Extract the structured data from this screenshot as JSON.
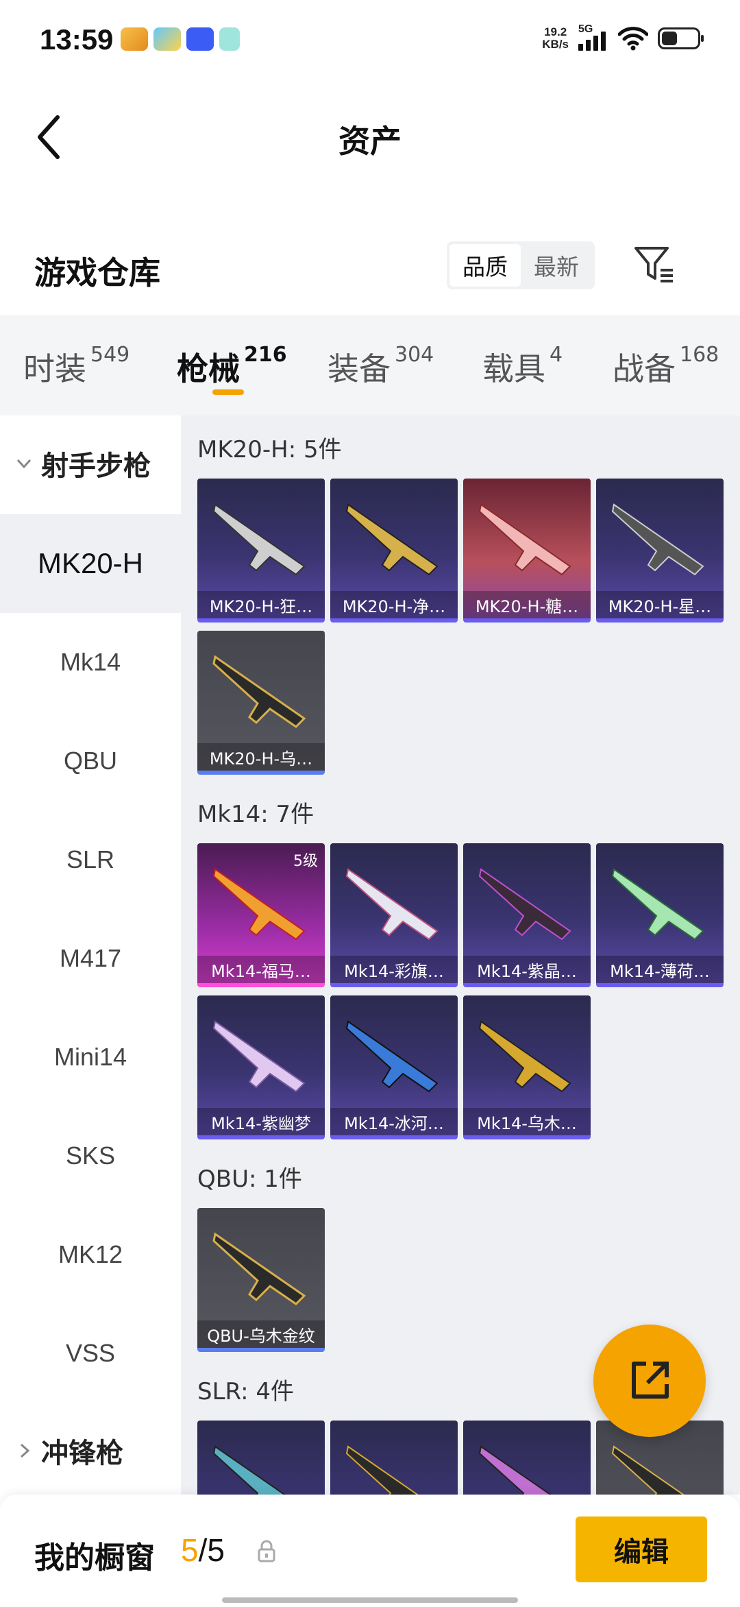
{
  "status": {
    "time": "13:59",
    "speed": "19.2",
    "speed_unit": "KB/s",
    "network": "5G"
  },
  "header": {
    "title": "资产"
  },
  "warehouse": {
    "title": "游戏仓库",
    "sort_options": [
      "品质",
      "最新"
    ],
    "active_sort": "品质"
  },
  "tabs": [
    {
      "label": "时装",
      "count": "549"
    },
    {
      "label": "枪械",
      "count": "216"
    },
    {
      "label": "装备",
      "count": "304"
    },
    {
      "label": "载具",
      "count": "4"
    },
    {
      "label": "战备",
      "count": "168"
    }
  ],
  "active_tab": "枪械",
  "sidebar": {
    "group1": "射手步枪",
    "items": [
      "MK20-H",
      "Mk14",
      "QBU",
      "SLR",
      "M417",
      "Mini14",
      "SKS",
      "MK12",
      "VSS"
    ],
    "active": "MK20-H",
    "group2": "冲锋枪"
  },
  "sections": [
    {
      "title": "MK20-H: 5件",
      "items": [
        "MK20-H-狂…",
        "MK20-H-净…",
        "MK20-H-糖…",
        "MK20-H-星…",
        "MK20-H-乌…"
      ]
    },
    {
      "title": "Mk14: 7件",
      "items": [
        "Mk14-福马…",
        "Mk14-彩旗…",
        "Mk14-紫晶…",
        "Mk14-薄荷…",
        "Mk14-紫幽梦",
        "Mk14-冰河…",
        "Mk14-乌木…"
      ],
      "level_badge": "5级"
    },
    {
      "title": "QBU: 1件",
      "items": [
        "QBU-乌木金纹"
      ]
    },
    {
      "title": "SLR: 4件",
      "items": []
    }
  ],
  "bottom": {
    "label": "我的橱窗",
    "count_current": "5",
    "count_sep": "/",
    "count_total": "5",
    "edit": "编辑"
  },
  "colors": {
    "accent": "#f5a300",
    "purple_card": "#3a3470",
    "pink_card": "#9a2da4"
  }
}
